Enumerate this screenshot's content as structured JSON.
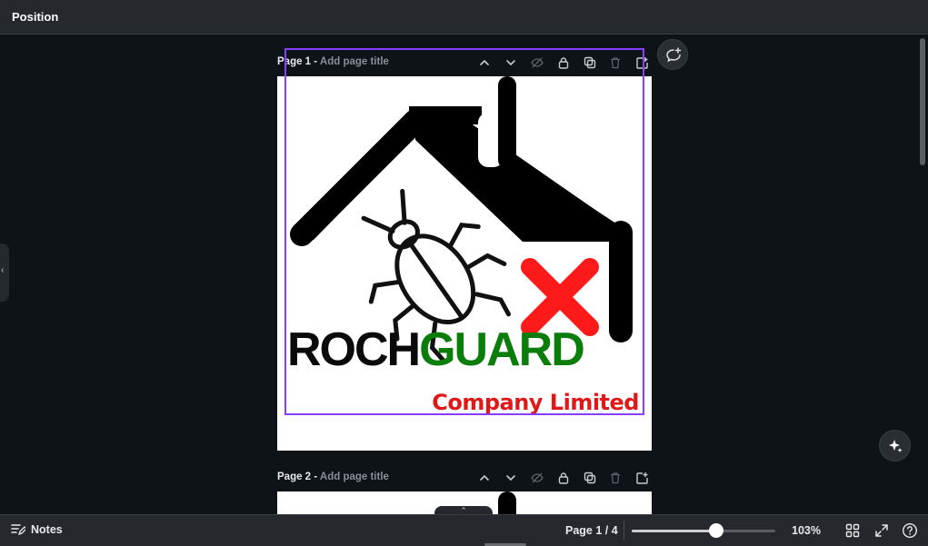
{
  "header": {
    "title": "Position"
  },
  "pages": [
    {
      "label": "Page 1 -",
      "title_placeholder": "Add page title"
    },
    {
      "label": "Page 2 -",
      "title_placeholder": "Add page title"
    }
  ],
  "design": {
    "brand_part1": "ROCH",
    "brand_part2": "GUARD",
    "tagline": "Company Limited",
    "colors": {
      "brand_dark": "#0a0a0a",
      "brand_green": "#0a7d0a",
      "tagline_red": "#e11818",
      "cross_red": "#ff1a1a",
      "selection": "#8b3dff"
    }
  },
  "footer": {
    "notes_label": "Notes",
    "page_indicator": "Page 1 / 4",
    "zoom": "103%",
    "zoom_slider_fraction": 0.55
  },
  "icons": [
    "chevron-up-icon",
    "chevron-down-icon",
    "hide-icon",
    "lock-icon",
    "duplicate-icon",
    "delete-icon",
    "add-page-icon",
    "comment-add-icon",
    "magic-sparkle-icon",
    "notes-icon",
    "grid-view-icon",
    "fullscreen-icon",
    "help-icon"
  ]
}
